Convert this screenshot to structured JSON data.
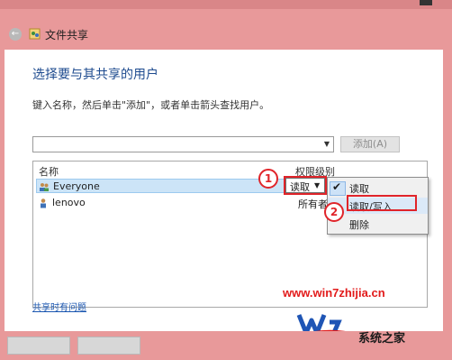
{
  "window": {
    "title": "文件共享"
  },
  "main": {
    "heading": "选择要与其共享的用户",
    "instruction": "键入名称，然后单击\"添加\"，或者单击箭头查找用户。",
    "name_input_value": "",
    "add_button_label": "添加(A)"
  },
  "grid": {
    "columns": [
      "名称",
      "权限级别"
    ],
    "rows": [
      {
        "name": "Everyone",
        "permission": "读取"
      },
      {
        "name": "lenovo",
        "permission": "所有者"
      }
    ]
  },
  "permission_menu": {
    "items": [
      "读取",
      "读取/写入",
      "删除"
    ],
    "checked_index": 0
  },
  "annotations": {
    "step1": "1",
    "step2": "2"
  },
  "links": {
    "trouble": "共享时有问题"
  },
  "watermark": {
    "url": "www.win7zhijia.cn",
    "logo_text": "Win7",
    "brand_text": "系统之家"
  },
  "colors": {
    "accent_red": "#e0242a",
    "heading_blue": "#1e4b8f",
    "background_pink": "#e8999a"
  }
}
